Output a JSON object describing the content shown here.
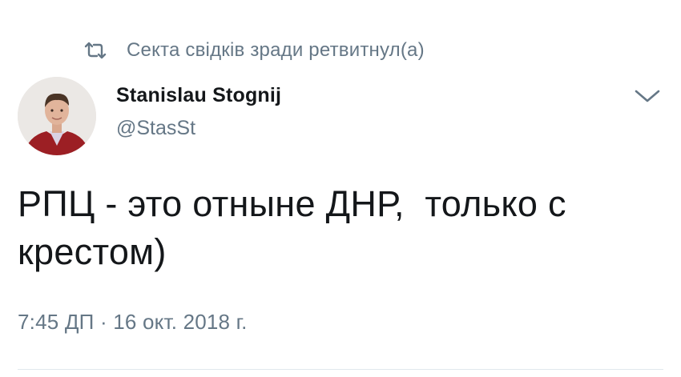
{
  "retweet": {
    "icon": "retweet-icon",
    "text": "Секта свідків зради ретвитнул(а)"
  },
  "author": {
    "avatar_icon": "avatar-photo",
    "display_name": "Stanislau Stognij",
    "handle": "@StasSt"
  },
  "menu": {
    "icon": "chevron-down-icon"
  },
  "tweet": {
    "text": "РПЦ - это отныне ДНР,  только с крестом)",
    "timestamp": "7:45 ДП · 16 окт. 2018 г."
  },
  "colors": {
    "primary_text": "#14171a",
    "secondary_text": "#657786",
    "divider": "#e1e8ed"
  }
}
